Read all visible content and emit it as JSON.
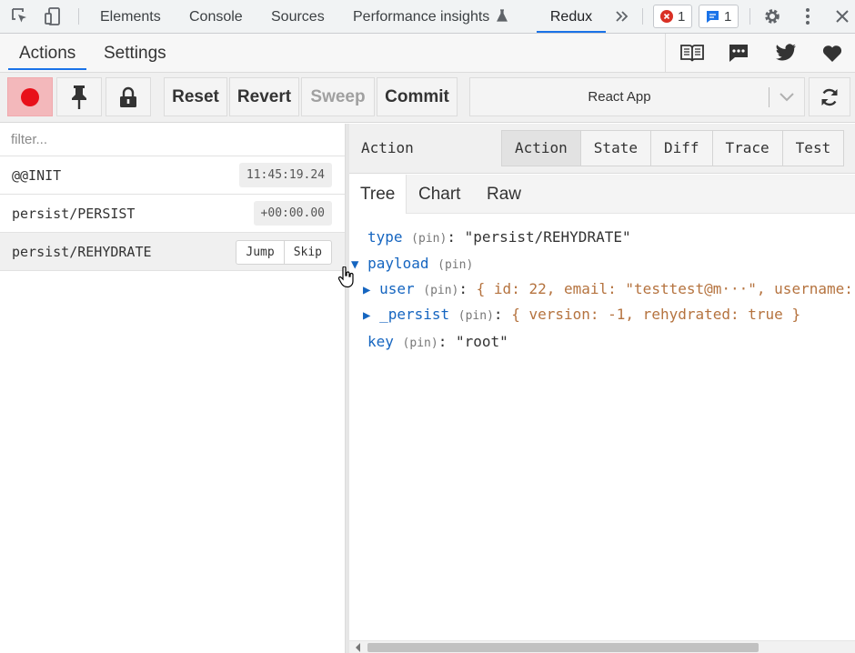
{
  "devtools": {
    "tabs": [
      "Elements",
      "Console",
      "Sources",
      "Performance insights",
      "Redux"
    ],
    "active_tab": "Redux",
    "error_count": "1",
    "message_count": "1"
  },
  "redux_tabs": {
    "items": [
      "Actions",
      "Settings"
    ],
    "active": "Actions"
  },
  "toolbar": {
    "reset": "Reset",
    "revert": "Revert",
    "sweep": "Sweep",
    "commit": "Commit",
    "instance": "React App"
  },
  "filter": {
    "placeholder": "filter..."
  },
  "actions": [
    {
      "name": "@@INIT",
      "time": "11:45:19.24"
    },
    {
      "name": "persist/PERSIST",
      "time": "+00:00.00"
    },
    {
      "name": "persist/REHYDRATE",
      "jump": "Jump",
      "skip": "Skip"
    }
  ],
  "inspector": {
    "title": "Action",
    "modes": [
      "Action",
      "State",
      "Diff",
      "Trace",
      "Test"
    ],
    "active_mode": "Action",
    "views": [
      "Tree",
      "Chart",
      "Raw"
    ],
    "active_view": "Tree"
  },
  "tree": {
    "pin": "(pin)",
    "type_key": "type",
    "type_value": "\"persist/REHYDRATE\"",
    "payload_key": "payload",
    "user_key": "user",
    "user_preview": "{ id: 22, email: \"testtest@m···\", username:",
    "persist_key": "_persist",
    "persist_preview": "{ version: -1, rehydrated: true }",
    "key_key": "key",
    "key_value": "\"root\""
  },
  "colors": {
    "accent": "#1a73e8",
    "record": "#e8101a",
    "tree_key": "#1565c0",
    "tree_preview": "#b5733f"
  }
}
